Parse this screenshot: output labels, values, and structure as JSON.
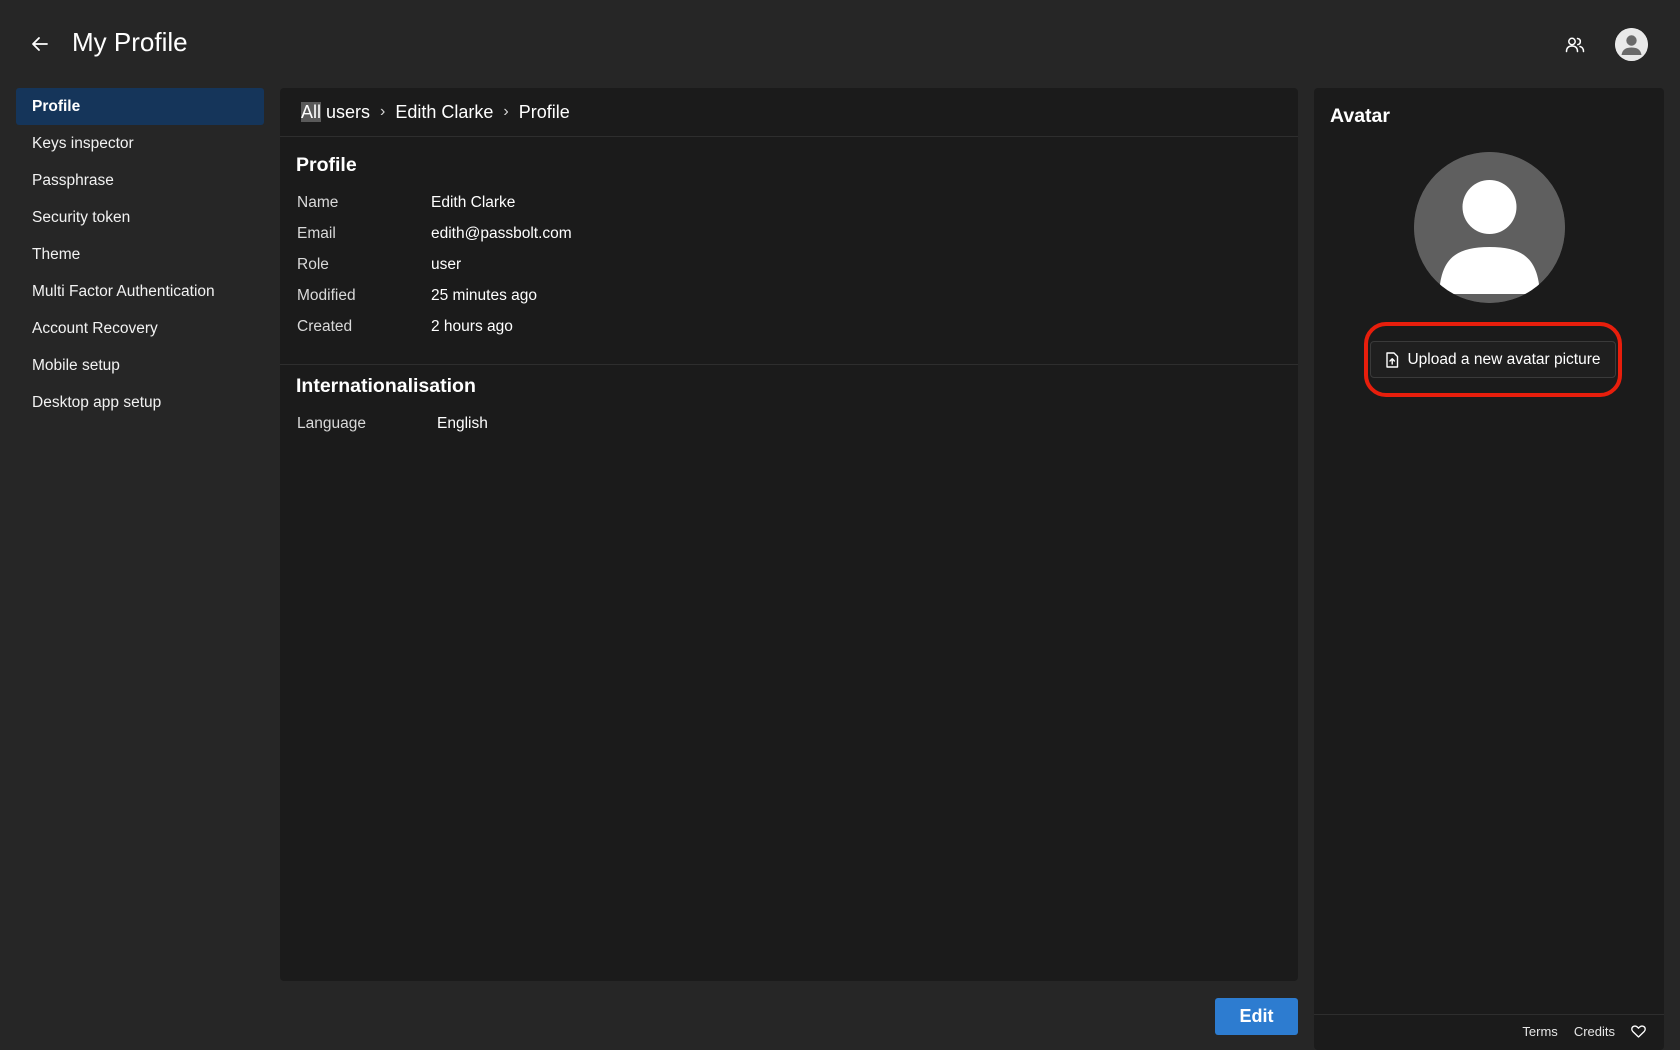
{
  "header": {
    "title": "My Profile",
    "back_icon": "arrow-left-icon",
    "users_icon": "users-icon",
    "avatar_icon": "user-avatar-icon"
  },
  "sidebar": {
    "items": [
      {
        "label": "Profile",
        "active": true
      },
      {
        "label": "Keys inspector"
      },
      {
        "label": "Passphrase"
      },
      {
        "label": "Security token"
      },
      {
        "label": "Theme"
      },
      {
        "label": "Multi Factor Authentication"
      },
      {
        "label": "Account Recovery"
      },
      {
        "label": "Mobile setup"
      },
      {
        "label": "Desktop app setup"
      }
    ]
  },
  "breadcrumbs": {
    "items": [
      "All users",
      "Edith Clarke",
      "Profile"
    ],
    "first_highlight": "All",
    "first_rest": " users",
    "separator": "›"
  },
  "profile": {
    "title": "Profile",
    "fields": [
      {
        "label": "Name",
        "value": "Edith Clarke"
      },
      {
        "label": "Email",
        "value": "edith@passbolt.com"
      },
      {
        "label": "Role",
        "value": "user"
      },
      {
        "label": "Modified",
        "value": "25 minutes ago"
      },
      {
        "label": "Created",
        "value": "2 hours ago"
      }
    ]
  },
  "internationalisation": {
    "title": "Internationalisation",
    "language_label": "Language",
    "language_value": "English"
  },
  "avatar_panel": {
    "title": "Avatar",
    "upload_label": "Upload a new avatar picture",
    "upload_icon": "file-upload-icon",
    "highlight_color": "#e81e0c"
  },
  "footer": {
    "terms": "Terms",
    "credits": "Credits",
    "heart_icon": "heart-icon"
  },
  "actions": {
    "edit_label": "Edit"
  },
  "colors": {
    "accent": "#2d7cd0",
    "active_nav": "#15355a",
    "background": "#262626",
    "panel": "#1b1b1b"
  }
}
